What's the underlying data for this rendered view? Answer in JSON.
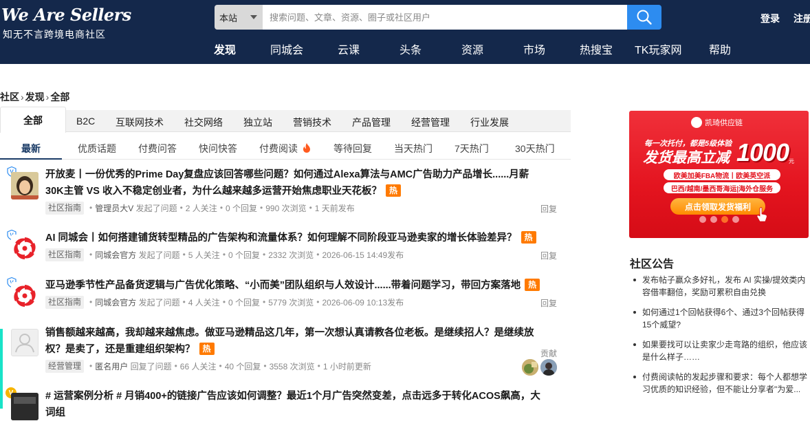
{
  "header": {
    "logo_title": "We Are Sellers",
    "logo_subtitle": "知无不言跨境电商社区",
    "search": {
      "scope": "本站",
      "placeholder": "搜索问题、文章、资源、圈子或社区用户"
    },
    "login": "登录",
    "register": "注册",
    "nav": [
      "发现",
      "同城会",
      "云课",
      "头条",
      "资源",
      "市场",
      "热搜宝",
      "TK玩家网",
      "帮助"
    ],
    "active_nav": "发现"
  },
  "breadcrumb": [
    "社区",
    "发现",
    "全部"
  ],
  "category_tabs": [
    "全部",
    "B2C",
    "互联网技术",
    "社交网络",
    "独立站",
    "营销技术",
    "产品管理",
    "经营管理",
    "行业发展"
  ],
  "filter_tabs": [
    "最新",
    "优质话题",
    "付费问答",
    "快问快答",
    "付费阅读",
    "等待回复",
    "当天热门",
    "7天热门",
    "30天热门"
  ],
  "hot_label": "热",
  "reply_label": "回复",
  "contribute_label": "贡献",
  "posts": [
    {
      "title": "开放麦丨一份优秀的Prime Day复盘应该回答哪些问题？如何通过Alexa算法与AMC广告助力产品增长......月薪30K主管 VS 收入不稳定创业者，为什么越来越多运营开始焦虑职业天花板？",
      "tag": "社区指南",
      "user": "管理员大V",
      "action": "发起了问题",
      "followers": "2 人关注",
      "replies": "0 个回复",
      "views": "990 次浏览",
      "time": "1 天前发布"
    },
    {
      "title": "AI 同城会丨如何搭建铺货转型精品的广告架构和流量体系？如何理解不同阶段亚马逊卖家的增长体验差异？",
      "tag": "社区指南",
      "user": "同城会官方",
      "action": "发起了问题",
      "followers": "5 人关注",
      "replies": "0 个回复",
      "views": "2332 次浏览",
      "time": "2026-06-15 14:49发布"
    },
    {
      "title": "亚马逊季节性产品备货逻辑与广告优化策略、“小而美”团队组织与人效设计......带着问题学习，带回方案落地",
      "tag": "社区指南",
      "user": "同城会官方",
      "action": "发起了问题",
      "followers": "4 人关注",
      "replies": "0 个回复",
      "views": "5779 次浏览",
      "time": "2026-06-09 10:13发布"
    },
    {
      "title": "销售额越来越高，我却越来越焦虑。做亚马逊精品这几年，第一次想认真请教各位老板。是继续招人？是继续放权？是卖了，还是重建组织架构？",
      "tag": "经营管理",
      "user": "匿名用户",
      "action": "回复了问题",
      "followers": "66 人关注",
      "replies": "40 个回复",
      "views": "3558 次浏览",
      "time": "1 小时前更新"
    },
    {
      "title": "# 运营案例分析 # 月销400+的链接广告应该如何调整？最近1个月广告突然变差，点击远多于转化ACOS飙高，大词组"
    }
  ],
  "ad": {
    "brand": "凯琦供应链",
    "line1": "每一次托付，都是5级体验",
    "line2": "发货最高立减",
    "amount": "1000",
    "unit": "元",
    "pill1": "欧美加美FBA物流丨欧美英空派",
    "pill2": "巴西/越南/墨西哥海运|海外仓服务",
    "cta": "点击领取发货福利"
  },
  "notice": {
    "title": "社区公告",
    "items": [
      "发布帖子赢众多好礼，发布 AI 实操/提效类内容借率翻倍，奖励可累积自由兑换",
      "如何通过1个回帖获得6个、通过3个回帖获得15个威望?",
      "如果要找可以让卖家少走弯路的组织，他应该是什么样子……",
      "付费阅读帖的发起步骤和要求：每个人都想学习优质的知识经验，但不能让分享者\"为爱..."
    ]
  },
  "colors": {
    "header_bg": "#14284b",
    "accent_blue": "#2d8cf0",
    "hot_orange": "#ff7a00",
    "ad_red": "#e4141f"
  }
}
